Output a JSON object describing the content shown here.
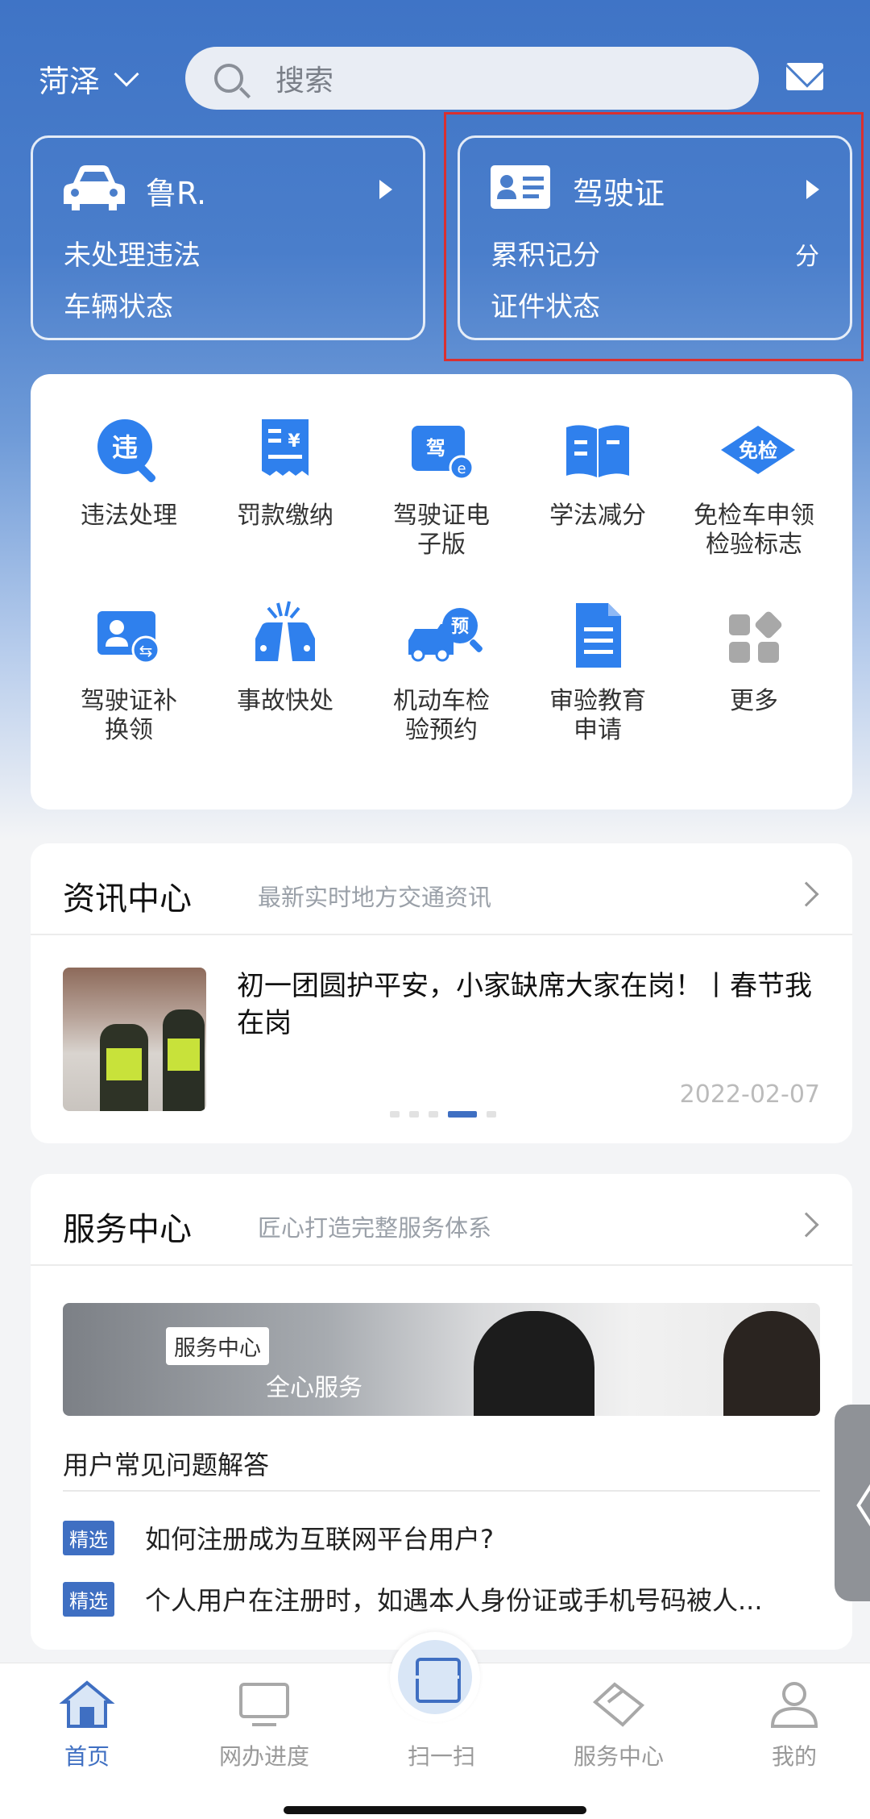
{
  "header": {
    "city": "菏泽",
    "search_placeholder": "搜索"
  },
  "vehicle_card": {
    "title": "鲁R.",
    "row1": "未处理违法",
    "row2": "车辆状态"
  },
  "license_card": {
    "title": "驾驶证",
    "row1": "累积记分",
    "unit": "分",
    "row2": "证件状态"
  },
  "services": [
    {
      "label": "违法处理",
      "icon": "violation-icon"
    },
    {
      "label": "罚款缴纳",
      "icon": "fine-icon"
    },
    {
      "label": "驾驶证电子版",
      "icon": "e-license-icon"
    },
    {
      "label": "学法减分",
      "icon": "study-icon"
    },
    {
      "label": "免检车申领检验标志",
      "icon": "exempt-icon"
    },
    {
      "label": "驾驶证补换领",
      "icon": "license-replace-icon"
    },
    {
      "label": "事故快处",
      "icon": "accident-icon"
    },
    {
      "label": "机动车检验预约",
      "icon": "inspection-icon"
    },
    {
      "label": "审验教育申请",
      "icon": "document-icon"
    },
    {
      "label": "更多",
      "icon": "more-icon"
    }
  ],
  "news": {
    "title": "资讯中心",
    "subtitle": "最新实时地方交通资讯",
    "headline": "初一团圆护平安，小家缺席大家在岗！丨春节我在岗",
    "date": "2022-02-07"
  },
  "service_center": {
    "title": "服务中心",
    "subtitle": "匠心打造完整服务体系",
    "banner_tag": "服务中心",
    "banner_slogan": "全心服务",
    "faq_title": "用户常见问题解答",
    "faq": [
      {
        "badge": "精选",
        "question": "如何注册成为互联网平台用户?"
      },
      {
        "badge": "精选",
        "question": "个人用户在注册时，如遇本人身份证或手机号码被人..."
      }
    ]
  },
  "side_tab": "〈",
  "nav": {
    "home": "首页",
    "progress": "网办进度",
    "scan": "扫一扫",
    "service": "服务中心",
    "mine": "我的"
  },
  "colors": {
    "brand": "#3f6fc2",
    "highlight": "#d93030"
  }
}
